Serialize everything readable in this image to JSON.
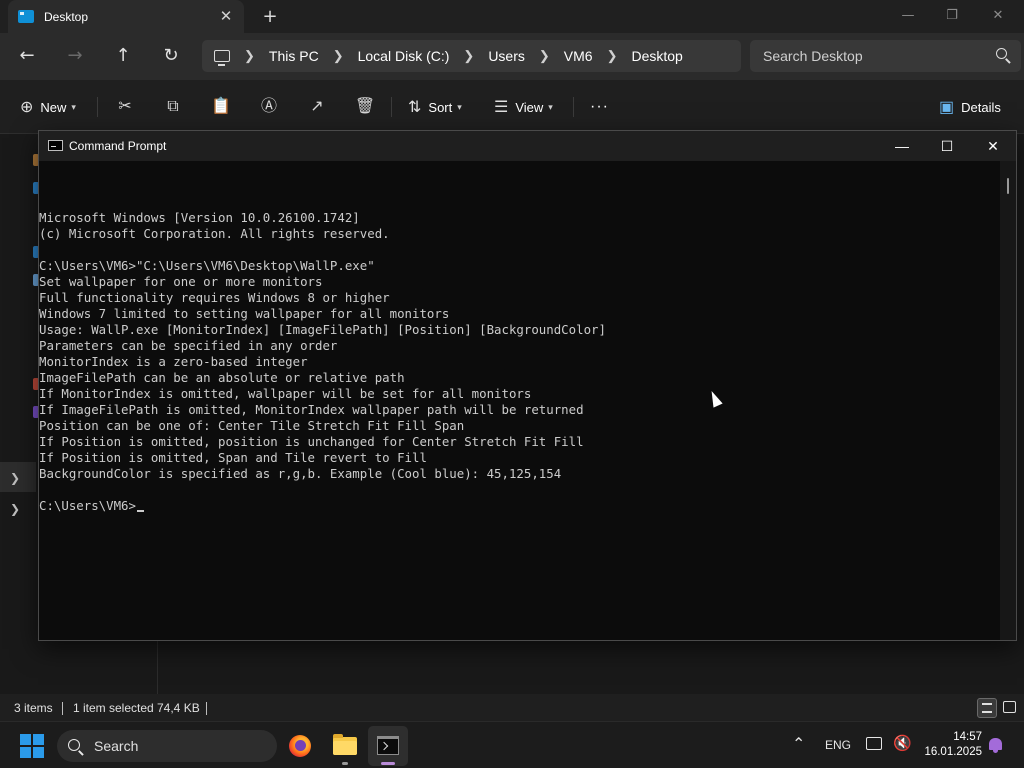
{
  "explorer": {
    "tab": {
      "label": "Desktop",
      "icon": "desktop-folder-icon"
    },
    "window_controls": {
      "minimize": "—",
      "maximize": "❐",
      "close": "✕"
    },
    "nav": {
      "back": "←",
      "forward": "→",
      "up": "↑",
      "refresh": "↻"
    },
    "breadcrumbs": [
      "This PC",
      "Local Disk (C:)",
      "Users",
      "VM6",
      "Desktop"
    ],
    "search": {
      "placeholder": "Search Desktop"
    },
    "toolbar": {
      "new_label": "New",
      "sort_label": "Sort",
      "view_label": "View",
      "more_label": "···",
      "details_label": "Details"
    },
    "status": {
      "items": "3 items",
      "selected": "1 item selected",
      "size": "74,4 KB"
    }
  },
  "cmd": {
    "title": "Command Prompt",
    "controls": {
      "minimize": "—",
      "maximize": "☐",
      "close": "✕"
    },
    "lines": [
      "Microsoft Windows [Version 10.0.26100.1742]",
      "(c) Microsoft Corporation. All rights reserved.",
      "",
      "C:\\Users\\VM6>\"C:\\Users\\VM6\\Desktop\\WallP.exe\"",
      "Set wallpaper for one or more monitors",
      "Full functionality requires Windows 8 or higher",
      "Windows 7 limited to setting wallpaper for all monitors",
      "Usage: WallP.exe [MonitorIndex] [ImageFilePath] [Position] [BackgroundColor]",
      "Parameters can be specified in any order",
      "MonitorIndex is a zero-based integer",
      "ImageFilePath can be an absolute or relative path",
      "If MonitorIndex is omitted, wallpaper will be set for all monitors",
      "If ImageFilePath is omitted, MonitorIndex wallpaper path will be returned",
      "Position can be one of: Center Tile Stretch Fit Fill Span",
      "If Position is omitted, position is unchanged for Center Stretch Fit Fill",
      "If Position is omitted, Span and Tile revert to Fill",
      "BackgroundColor is specified as r,g,b. Example (Cool blue): 45,125,154",
      ""
    ],
    "prompt": "C:\\Users\\VM6>"
  },
  "taskbar": {
    "search_label": "Search",
    "apps": [
      "firefox-icon",
      "file-explorer-icon",
      "terminal-icon"
    ],
    "tray": {
      "overflow": "⌃",
      "language": "ENG",
      "time": "14:57",
      "date": "16.01.2025"
    }
  },
  "colors": {
    "accent": "#2b9bea",
    "console_bg": "#0c0c0c",
    "console_fg": "#cccccc",
    "notification": "#a36bd9"
  }
}
